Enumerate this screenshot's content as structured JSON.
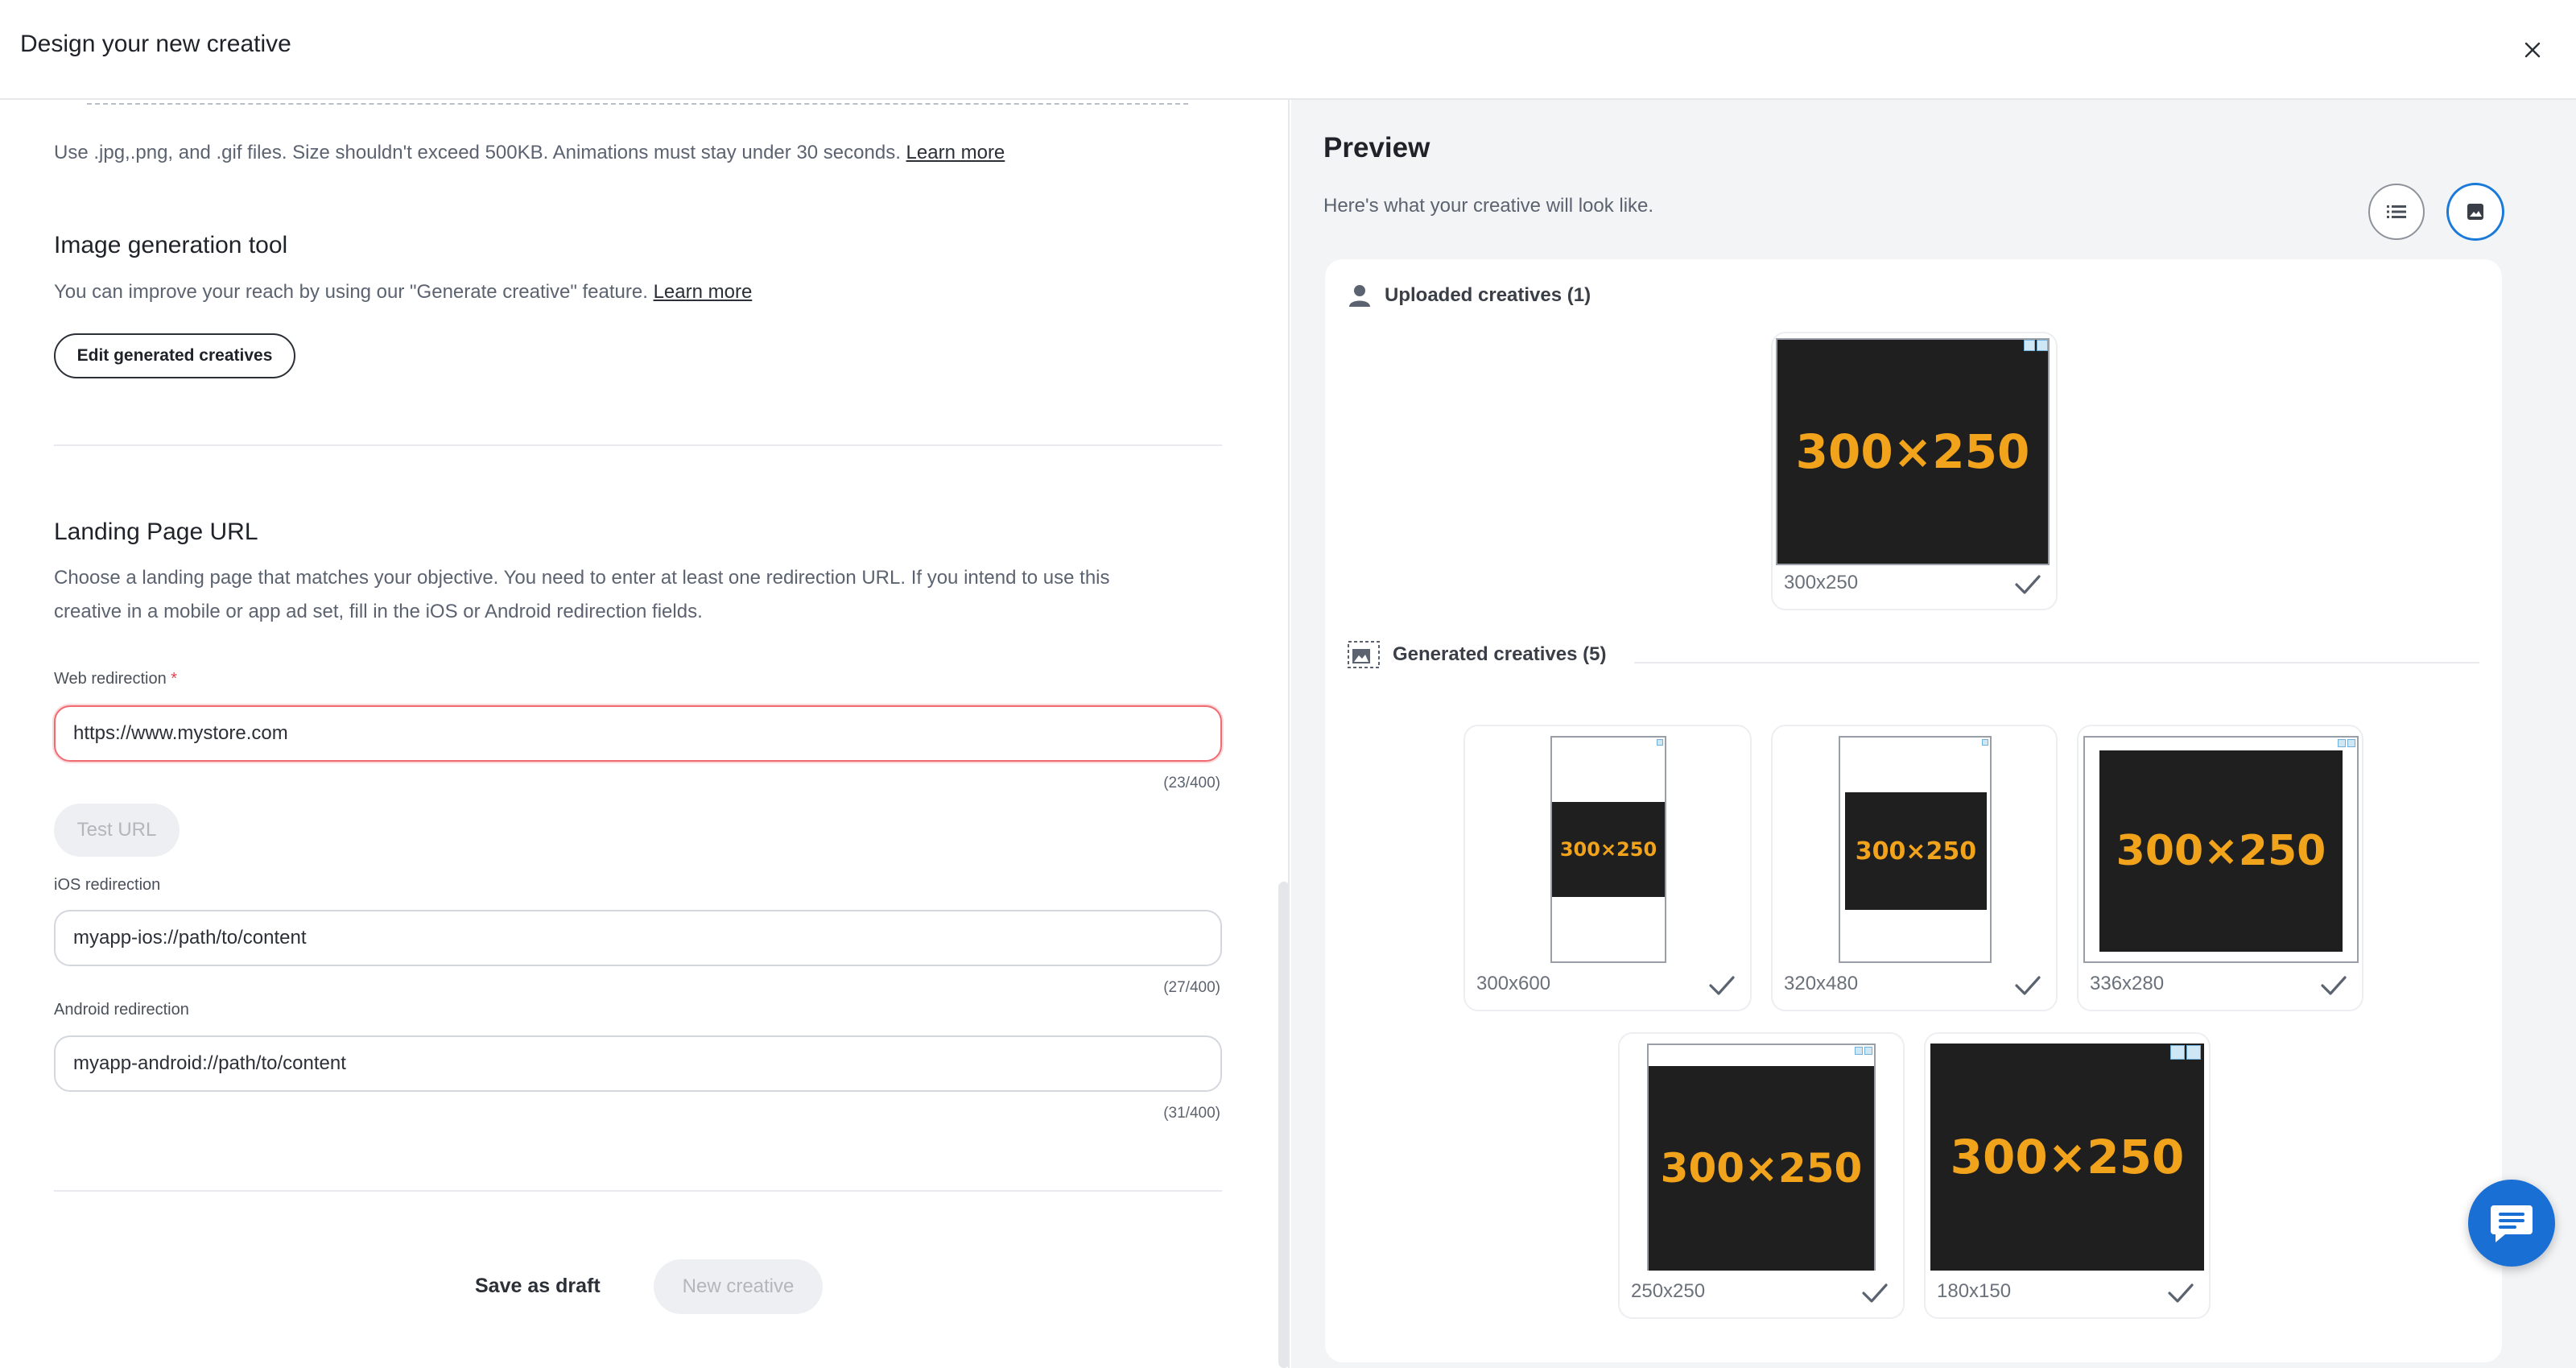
{
  "header": {
    "title": "Design your new creative",
    "close_icon": "close-icon"
  },
  "upload": {
    "hint": "Use .jpg,.png, and .gif files. Size shouldn't exceed 500KB. Animations must stay under 30 seconds.",
    "learn_more": "Learn more"
  },
  "image_generation": {
    "title": "Image generation tool",
    "description": "You can improve your reach by using our \"Generate creative\" feature.",
    "learn_more": "Learn more",
    "edit_button": "Edit generated creatives"
  },
  "landing_page": {
    "title": "Landing Page URL",
    "description_line1": "Choose a landing page that matches your objective. You need to enter at least one redirection URL. If you intend to use this",
    "description_line2": "creative in a mobile or app ad set, fill in the iOS or Android redirection fields.",
    "web": {
      "label": "Web redirection",
      "required_mark": "*",
      "value": "https://www.mystore.com",
      "counter": "(23/400)"
    },
    "test_url_button": "Test URL",
    "ios": {
      "label": "iOS redirection",
      "value": "myapp-ios://path/to/content",
      "counter": "(27/400)"
    },
    "android": {
      "label": "Android redirection",
      "value": "myapp-android://path/to/content",
      "counter": "(31/400)"
    }
  },
  "footer": {
    "save_draft": "Save as draft",
    "new_creative": "New creative"
  },
  "preview": {
    "title": "Preview",
    "subtitle": "Here's what your creative will look like.",
    "list_view_icon": "list-view-icon",
    "image_view_icon": "image-view-icon",
    "image_view_active": true,
    "uploaded": {
      "heading": "Uploaded creatives (1)",
      "items": [
        {
          "size": "300x250",
          "ad_text": "300×250",
          "selected": true
        }
      ]
    },
    "generated": {
      "heading": "Generated creatives (5)",
      "items": [
        {
          "size": "300x600",
          "ad_text": "300×250",
          "selected": true
        },
        {
          "size": "320x480",
          "ad_text": "300×250",
          "selected": true
        },
        {
          "size": "336x280",
          "ad_text": "300×250",
          "selected": true
        },
        {
          "size": "250x250",
          "ad_text": "300×250",
          "selected": true
        },
        {
          "size": "180x150",
          "ad_text": "300×250",
          "selected": true
        }
      ]
    }
  },
  "chat": {
    "icon": "chat-icon"
  },
  "colors": {
    "accent": "#1a6fd4",
    "ad_background": "#1f1f1f",
    "ad_text": "#f2a31c",
    "error": "#f06a72"
  }
}
